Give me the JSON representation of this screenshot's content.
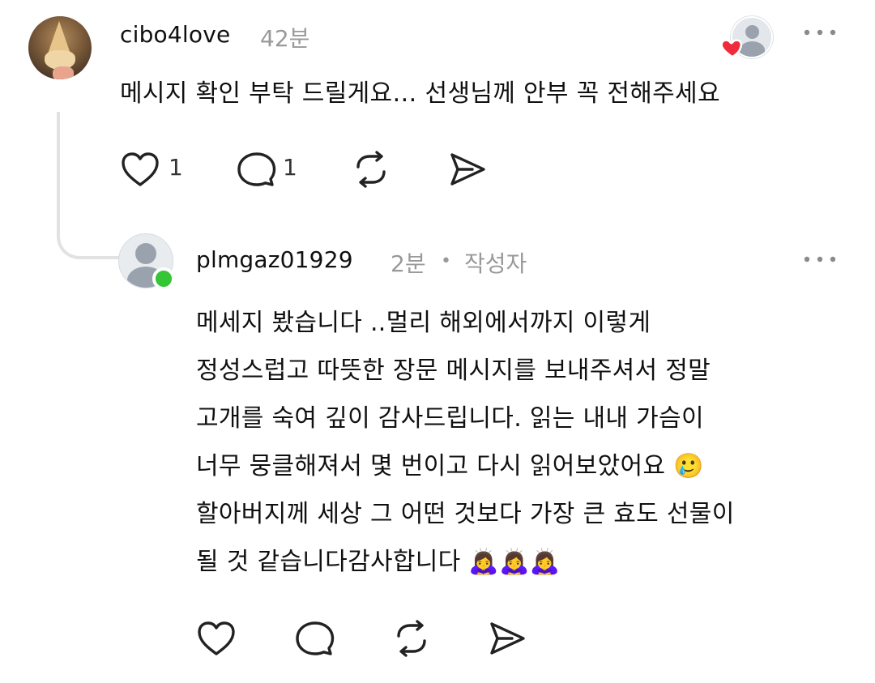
{
  "comment": {
    "username": "cibo4love",
    "time": "42분",
    "text": "메시지 확인 부탁 드릴게요… 선생님께 안부 꼭 전해주세요",
    "like_count": "1",
    "reply_count": "1",
    "avatar_icon": "ice-cream-cone-photo",
    "liked_by_badge_icon": "red-heart-icon"
  },
  "reply": {
    "username": "plmgaz01929",
    "time": "2분",
    "separator": "•",
    "author_badge": "작성자",
    "lines": [
      "메세지 봤습니다 ..멀리 해외에서까지 이렇게",
      "정성스럽고 따뜻한 장문 메시지를 보내주셔서 정말",
      "고개를 숙여 깊이 감사드립니다. 읽는 내내 가슴이",
      "너무 뭉클해져서 몇 번이고 다시 읽어보았어요",
      "할아버지께 세상 그 어떤 것보다 가장 큰 효도 선물이",
      "될 것 같습니다감사합니다"
    ],
    "line4_emoji": "🥲",
    "line6_emoji": "🙇‍♀️🙇‍♀️🙇‍♀️",
    "online_color": "#35c535"
  },
  "icons": {
    "like": "heart-icon",
    "reply": "speech-bubble-icon",
    "repost": "repost-icon",
    "share": "send-icon",
    "more": "more-dots-icon"
  }
}
